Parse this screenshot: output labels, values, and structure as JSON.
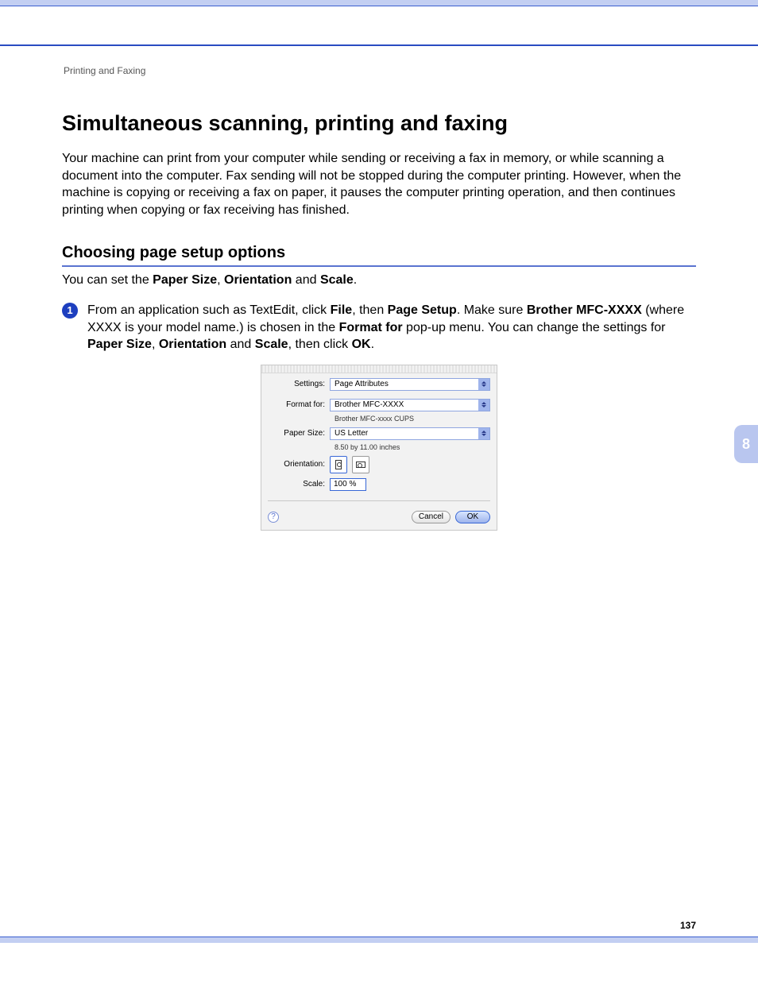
{
  "breadcrumb": "Printing and Faxing",
  "title": "Simultaneous scanning, printing and faxing",
  "intro": "Your machine can print from your computer while sending or receiving a fax in memory, or while scanning a document into the computer. Fax sending will not be stopped during the computer printing. However, when the machine is copying or receiving a fax on paper, it pauses the computer printing operation, and then continues printing when copying or fax receiving has finished.",
  "sub_heading": "Choosing page setup options",
  "setup_intro_pre": "You can set the ",
  "setup_intro_b1": "Paper Size",
  "setup_intro_mid1": ", ",
  "setup_intro_b2": "Orientation",
  "setup_intro_mid2": " and ",
  "setup_intro_b3": "Scale",
  "setup_intro_post": ".",
  "step_num": "1",
  "step": {
    "t1": "From an application such as TextEdit, click ",
    "b1": "File",
    "t2": ", then ",
    "b2": "Page Setup",
    "t3": ". Make sure ",
    "b3": "Brother MFC-XXXX",
    "t4": " (where XXXX is your model name.) is chosen in the ",
    "b4": "Format for",
    "t5": " pop-up menu. You can change the settings for ",
    "b5": "Paper Size",
    "t6": ", ",
    "b6": "Orientation",
    "t7": " and ",
    "b7": "Scale",
    "t8": ", then click ",
    "b8": "OK",
    "t9": "."
  },
  "dialog": {
    "settings_label": "Settings:",
    "settings_value": "Page Attributes",
    "format_label": "Format for:",
    "format_value": "Brother MFC-XXXX",
    "format_sub": "Brother MFC-xxxx CUPS",
    "paper_label": "Paper Size:",
    "paper_value": "US Letter",
    "paper_sub": "8.50 by 11.00 inches",
    "orient_label": "Orientation:",
    "scale_label": "Scale:",
    "scale_value": "100 %",
    "help": "?",
    "cancel": "Cancel",
    "ok": "OK"
  },
  "chapter": "8",
  "page_num": "137"
}
